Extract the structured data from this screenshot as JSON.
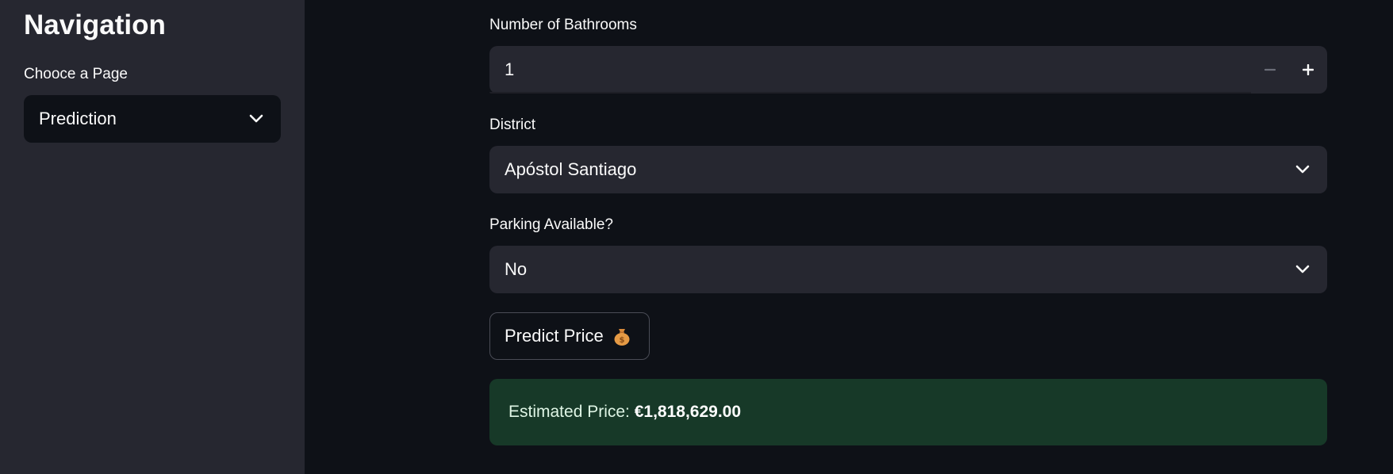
{
  "sidebar": {
    "title": "Navigation",
    "page_select_label": "Chooce a Page",
    "page_select_value": "Prediction"
  },
  "form": {
    "bathrooms": {
      "label": "Number of Bathrooms",
      "value": "1"
    },
    "district": {
      "label": "District",
      "value": "Apóstol Santiago"
    },
    "parking": {
      "label": "Parking Available?",
      "value": "No"
    },
    "predict_button_label": "Predict Price"
  },
  "result": {
    "prefix": "Estimated Price: ",
    "amount": "€1,818,629.00"
  },
  "icons": {
    "chevron": "chevron-down-icon",
    "minus": "minus-icon",
    "plus": "plus-icon",
    "money_bag": "money-bag-icon"
  },
  "colors": {
    "app_bg": "#0e1117",
    "sidebar_bg": "#262730",
    "input_bg": "#262730",
    "success_bg": "#173928",
    "text": "#fafafa"
  }
}
